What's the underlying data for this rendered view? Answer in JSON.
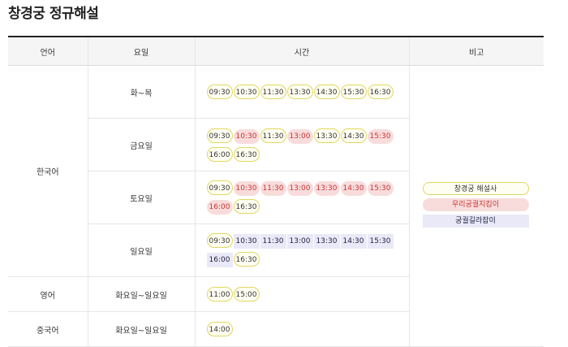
{
  "page": {
    "title": "창경궁 정규해설"
  },
  "headers": {
    "lang": "언어",
    "day": "요일",
    "time": "시간",
    "note": "비고"
  },
  "rows": [
    {
      "lang": "한국어",
      "day": "화~목",
      "times": [
        {
          "t": "09:30",
          "c": "y"
        },
        {
          "t": "10:30",
          "c": "y"
        },
        {
          "t": "11:30",
          "c": "y"
        },
        {
          "t": "13:30",
          "c": "y"
        },
        {
          "t": "14:30",
          "c": "y"
        },
        {
          "t": "15:30",
          "c": "y"
        },
        {
          "t": "16:30",
          "c": "y"
        }
      ]
    },
    {
      "lang": "",
      "day": "금요일",
      "times": [
        {
          "t": "09:30",
          "c": "y"
        },
        {
          "t": "10:30",
          "c": "r"
        },
        {
          "t": "11:30",
          "c": "y"
        },
        {
          "t": "13:00",
          "c": "r"
        },
        {
          "t": "13:30",
          "c": "y"
        },
        {
          "t": "14:30",
          "c": "y"
        },
        {
          "t": "15:30",
          "c": "r"
        },
        {
          "t": "16:00",
          "c": "y"
        },
        {
          "t": "16:30",
          "c": "y"
        }
      ]
    },
    {
      "lang": "",
      "day": "토요일",
      "times": [
        {
          "t": "09:30",
          "c": "y"
        },
        {
          "t": "10:30",
          "c": "r"
        },
        {
          "t": "11:30",
          "c": "r"
        },
        {
          "t": "13:00",
          "c": "r"
        },
        {
          "t": "13:30",
          "c": "r"
        },
        {
          "t": "14:30",
          "c": "r"
        },
        {
          "t": "15:30",
          "c": "r"
        },
        {
          "t": "16:00",
          "c": "r"
        },
        {
          "t": "16:30",
          "c": "y"
        }
      ]
    },
    {
      "lang": "",
      "day": "일요일",
      "times": [
        {
          "t": "09:30",
          "c": "y"
        },
        {
          "t": "10:30",
          "c": "b"
        },
        {
          "t": "11:30",
          "c": "b"
        },
        {
          "t": "13:00",
          "c": "b"
        },
        {
          "t": "13:30",
          "c": "b"
        },
        {
          "t": "14:30",
          "c": "b"
        },
        {
          "t": "15:30",
          "c": "b"
        },
        {
          "t": "16:00",
          "c": "b"
        },
        {
          "t": "16:30",
          "c": "y"
        }
      ]
    },
    {
      "lang": "영어",
      "day": "화요일~일요일",
      "times": [
        {
          "t": "11:00",
          "c": "y"
        },
        {
          "t": "15:00",
          "c": "y"
        }
      ]
    },
    {
      "lang": "중국어",
      "day": "화요일~일요일",
      "times": [
        {
          "t": "14:00",
          "c": "y"
        }
      ]
    }
  ],
  "legend": [
    {
      "label": "창경궁 해설사",
      "c": "y"
    },
    {
      "label": "우리궁궐지킴이",
      "c": "r"
    },
    {
      "label": "궁궐길라잡이",
      "c": "b"
    }
  ],
  "colors": {
    "yellow_border": "#e0d860",
    "red_bg": "#f8dcdc",
    "red_text": "#cc3333",
    "blue_bg": "#e9e9f7"
  }
}
